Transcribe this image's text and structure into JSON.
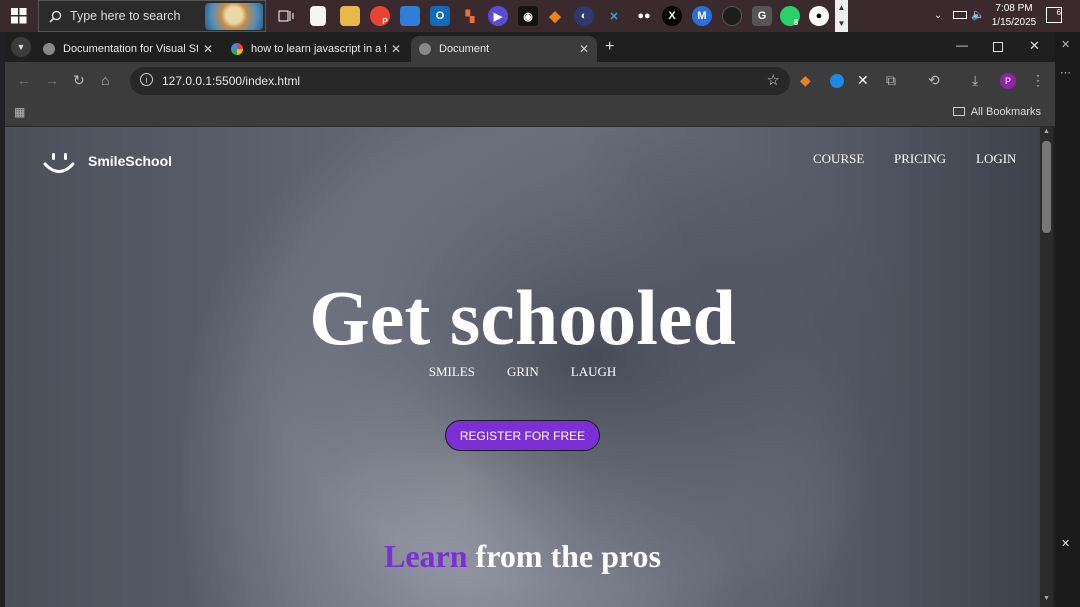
{
  "taskbar": {
    "search_placeholder": "Type here to search",
    "time": "7:08 PM",
    "date": "1/15/2025",
    "notification_count": "6",
    "whatsapp_badge": "8",
    "profile_letter": "P",
    "g_letter": "G"
  },
  "browser": {
    "tabs": [
      {
        "title": "Documentation for Visual Studio"
      },
      {
        "title": "how to learn javascript in a fun"
      },
      {
        "title": "Document"
      }
    ],
    "url": "127.0.0.1:5500/index.html",
    "bookmarks_label": "All Bookmarks",
    "profile_letter": "P"
  },
  "page": {
    "brand": "SmileSchool",
    "nav": [
      "COURSE",
      "PRICING",
      "LOGIN"
    ],
    "hero_title": "Get schooled",
    "subtitle": [
      "SMILES",
      "GRIN",
      "LAUGH"
    ],
    "cta": "REGISTER FOR FREE",
    "section_accent": "Learn",
    "section_rest": " from the pros",
    "accent_color": "#7d2fd6"
  }
}
